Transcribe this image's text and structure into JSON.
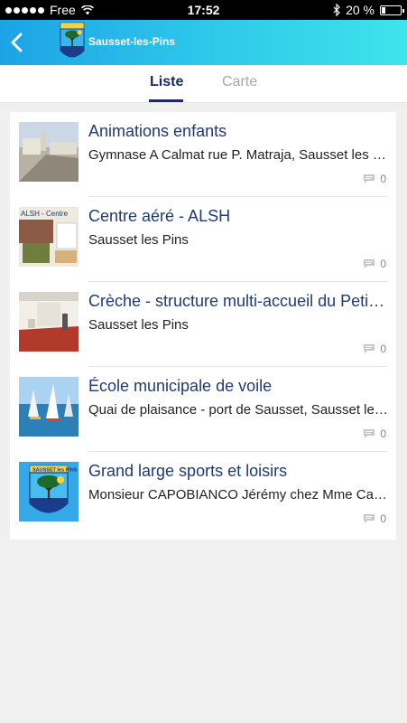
{
  "status_bar": {
    "carrier": "Free",
    "time": "17:52",
    "battery": "20 %",
    "battery_level": 0.2
  },
  "header": {
    "title": "Sausset-les-Pins",
    "logo_text": "SAUSSET les PINS"
  },
  "tabs": [
    {
      "label": "Liste",
      "active": true
    },
    {
      "label": "Carte",
      "active": false
    }
  ],
  "items": [
    {
      "title": "Animations enfants",
      "subtitle": "Gymnase A Calmat rue P. Matraja, Sausset les Pins",
      "comments": "0",
      "thumb": "village-street-photo"
    },
    {
      "title": "Centre aéré - ALSH",
      "subtitle": "Sausset les Pins",
      "comments": "0",
      "thumb": "alsh-poster-photo",
      "thumb_text": "ALSH - Centre"
    },
    {
      "title": "Crèche - structure multi-accueil du Petit Prince",
      "subtitle": "Sausset les Pins",
      "comments": "0",
      "thumb": "nursery-room-photo"
    },
    {
      "title": "École municipale de voile",
      "subtitle": "Quai de plaisance - port de Sausset, Sausset les Pins",
      "comments": "0",
      "thumb": "sailboats-photo"
    },
    {
      "title": "Grand large sports et loisirs",
      "subtitle": "Monsieur CAPOBIANCO Jérémy chez Mme Capobianco",
      "comments": "0",
      "thumb": "town-logo"
    }
  ]
}
